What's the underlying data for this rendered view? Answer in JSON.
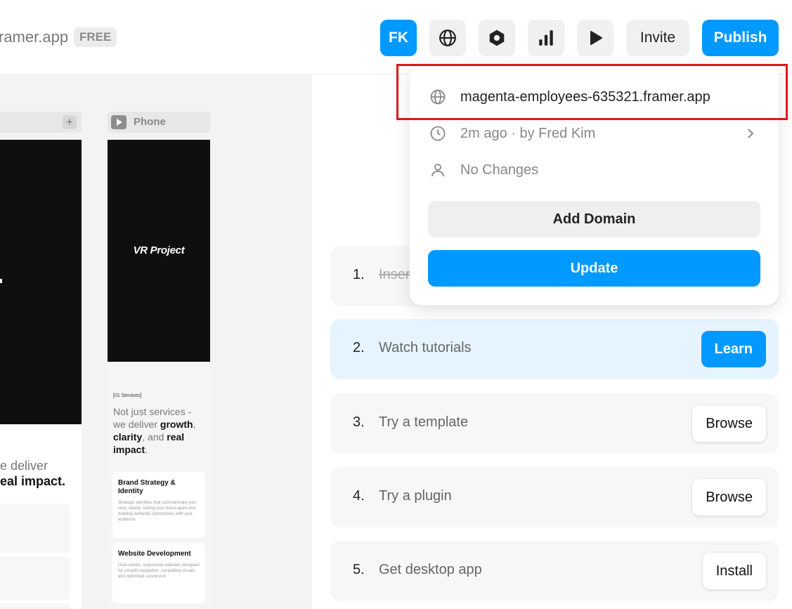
{
  "topbar": {
    "site_name": "ramer.app",
    "plan_badge": "FREE",
    "avatar_initials": "FK",
    "invite_label": "Invite",
    "publish_label": "Publish"
  },
  "canvas": {
    "phone_label": "Phone",
    "left_text_line1": "e deliver",
    "left_text_line2": "eal impact.",
    "phone_hero_title": "VR Project",
    "services_tag": "[01 Services]",
    "headline_part1": "Not just services - we deliver ",
    "headline_bold1": "growth",
    "headline_part2": ", ",
    "headline_bold2": "clarity",
    "headline_part3": ", and ",
    "headline_bold3": "real impact",
    "headline_part4": ".",
    "card1_title": "Brand Strategy & Identity",
    "card1_body": "Strategic identities that communicate your story clearly, setting your brand apart and building authentic connections with your audience.",
    "card2_title": "Website Development",
    "card2_body": "User-centric, responsive websites designed for smooth navigation, compelling visuals, and optimized conversion."
  },
  "dropdown": {
    "url": "magenta-employees-635321.framer.app",
    "time_info": "2m ago · by Fred Kim",
    "changes": "No Changes",
    "add_domain_label": "Add Domain",
    "update_label": "Update"
  },
  "steps": [
    {
      "num": "1.",
      "label": "Inser",
      "button": ""
    },
    {
      "num": "2.",
      "label": "Watch tutorials",
      "button": "Learn"
    },
    {
      "num": "3.",
      "label": "Try a template",
      "button": "Browse"
    },
    {
      "num": "4.",
      "label": "Try a plugin",
      "button": "Browse"
    },
    {
      "num": "5.",
      "label": "Get desktop app",
      "button": "Install"
    }
  ],
  "colors": {
    "accent": "#0099ff",
    "highlight": "#e0161b",
    "active_step_bg": "#e5f4ff"
  }
}
